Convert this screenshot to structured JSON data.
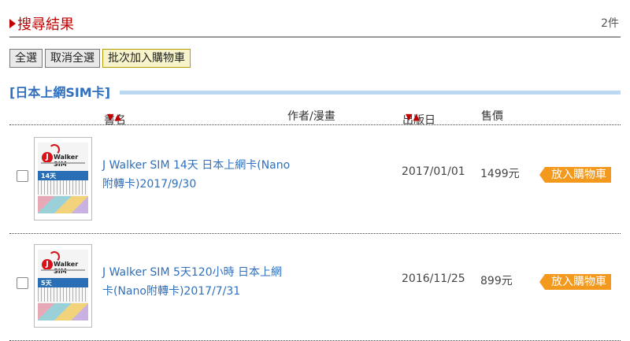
{
  "header": {
    "title": "搜尋結果",
    "count": "2件"
  },
  "actions": {
    "select_all": "全選",
    "cancel_select_all": "取消全選",
    "batch_add": "批次加入購物車"
  },
  "category": {
    "label": "[日本上網SIM卡]"
  },
  "columns": {
    "name": "書名",
    "name_sort": "▼▲",
    "author": "作者/漫畫",
    "date": "出版日",
    "date_sort": "▼▲",
    "price": "售價"
  },
  "items": [
    {
      "name": "J Walker SIM 14天 日本上網卡(Nano附轉卡)2017/9/30",
      "date": "2017/01/01",
      "price": "1499元",
      "cart": "放入購物車",
      "thumb": {
        "brand_j": "J",
        "brand_text": "Walker SIM",
        "days": "14天"
      }
    },
    {
      "name": "J Walker SIM 5天120小時 日本上網卡(Nano附轉卡)2017/7/31",
      "date": "2016/11/25",
      "price": "899元",
      "cart": "放入購物車",
      "thumb": {
        "brand_j": "J",
        "brand_text": "Walker SIM",
        "days": "5天"
      }
    }
  ]
}
